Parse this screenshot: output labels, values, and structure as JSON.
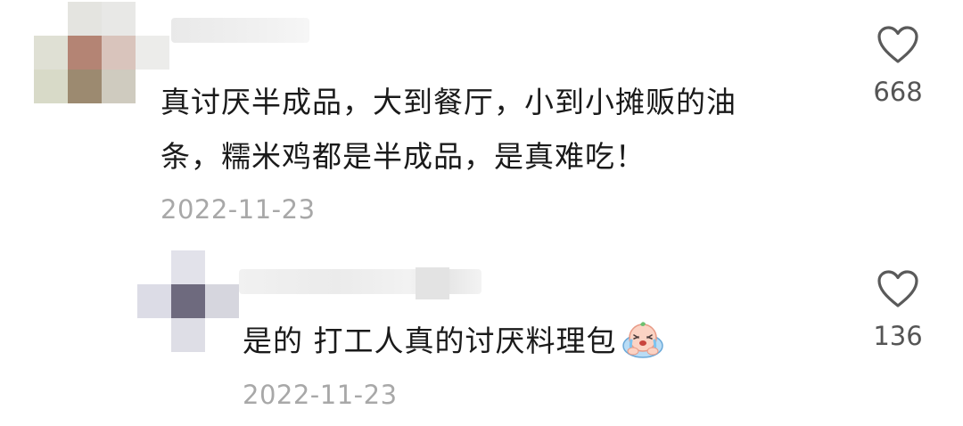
{
  "comments": [
    {
      "text_line1": "真讨厌半成品，大到餐厅，小到小摊贩的油",
      "text_line2": "条，糯米鸡都是半成品，是真难吃！",
      "date": "2022-11-23",
      "likes": "668",
      "icons": {
        "like": "heart-outline-icon"
      }
    },
    {
      "text": "是的 打工人真的讨厌料理包",
      "emoji": "crying-face-emoji",
      "date": "2022-11-23",
      "likes": "136",
      "icons": {
        "like": "heart-outline-icon"
      }
    }
  ],
  "colors": {
    "text": "#1a1a1a",
    "date": "#a8a8a8",
    "count": "#555555",
    "icon": "#5a5a5a"
  }
}
